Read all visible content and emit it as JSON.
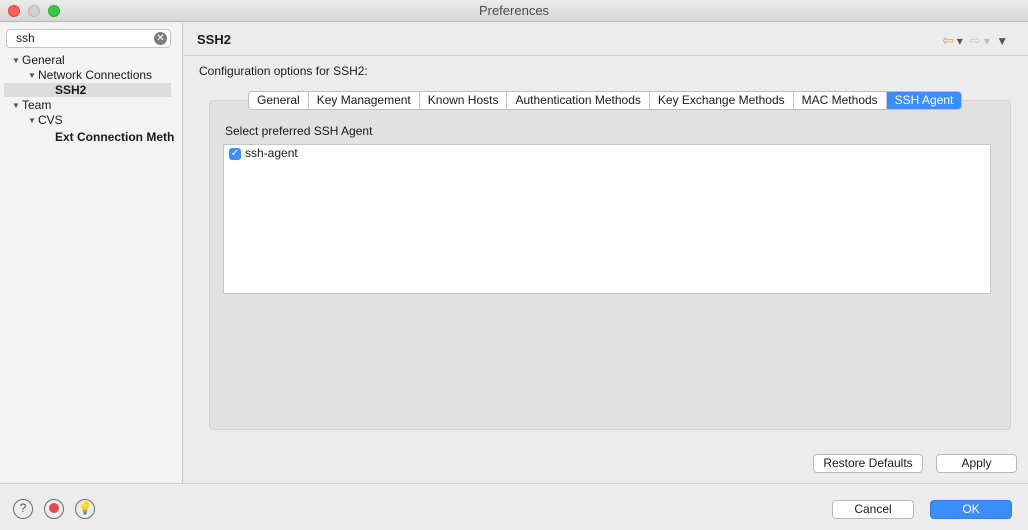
{
  "window": {
    "title": "Preferences"
  },
  "sidebar": {
    "search_value": "ssh",
    "tree": [
      {
        "label": "General",
        "expanded": true
      },
      {
        "label": "Network Connections",
        "expanded": true
      },
      {
        "label": "SSH2",
        "selected": true
      },
      {
        "label": "Team",
        "expanded": true
      },
      {
        "label": "CVS",
        "expanded": true
      },
      {
        "label": "Ext Connection Meth"
      }
    ]
  },
  "page": {
    "title": "SSH2",
    "description": "Configuration options for SSH2:",
    "tabs": [
      {
        "label": "General"
      },
      {
        "label": "Key Management"
      },
      {
        "label": "Known Hosts"
      },
      {
        "label": "Authentication Methods"
      },
      {
        "label": "Key Exchange Methods"
      },
      {
        "label": "MAC Methods"
      },
      {
        "label": "SSH Agent",
        "active": true
      }
    ],
    "agent_label": "Select preferred SSH Agent",
    "agents": [
      {
        "label": "ssh-agent",
        "checked": true
      }
    ],
    "restore_defaults": "Restore Defaults",
    "apply": "Apply"
  },
  "footer": {
    "cancel": "Cancel",
    "ok": "OK"
  },
  "icons": {
    "nav_back": "back-arrow-icon",
    "nav_forward": "forward-arrow-icon",
    "menu": "view-menu-icon",
    "help": "help-icon",
    "record": "record-macro-icon",
    "tip": "lightbulb-icon"
  },
  "colors": {
    "accent": "#3a8ef5",
    "close": "#fc5f57",
    "maximize": "#34c84a",
    "back_arrow": "#e3a23b"
  }
}
